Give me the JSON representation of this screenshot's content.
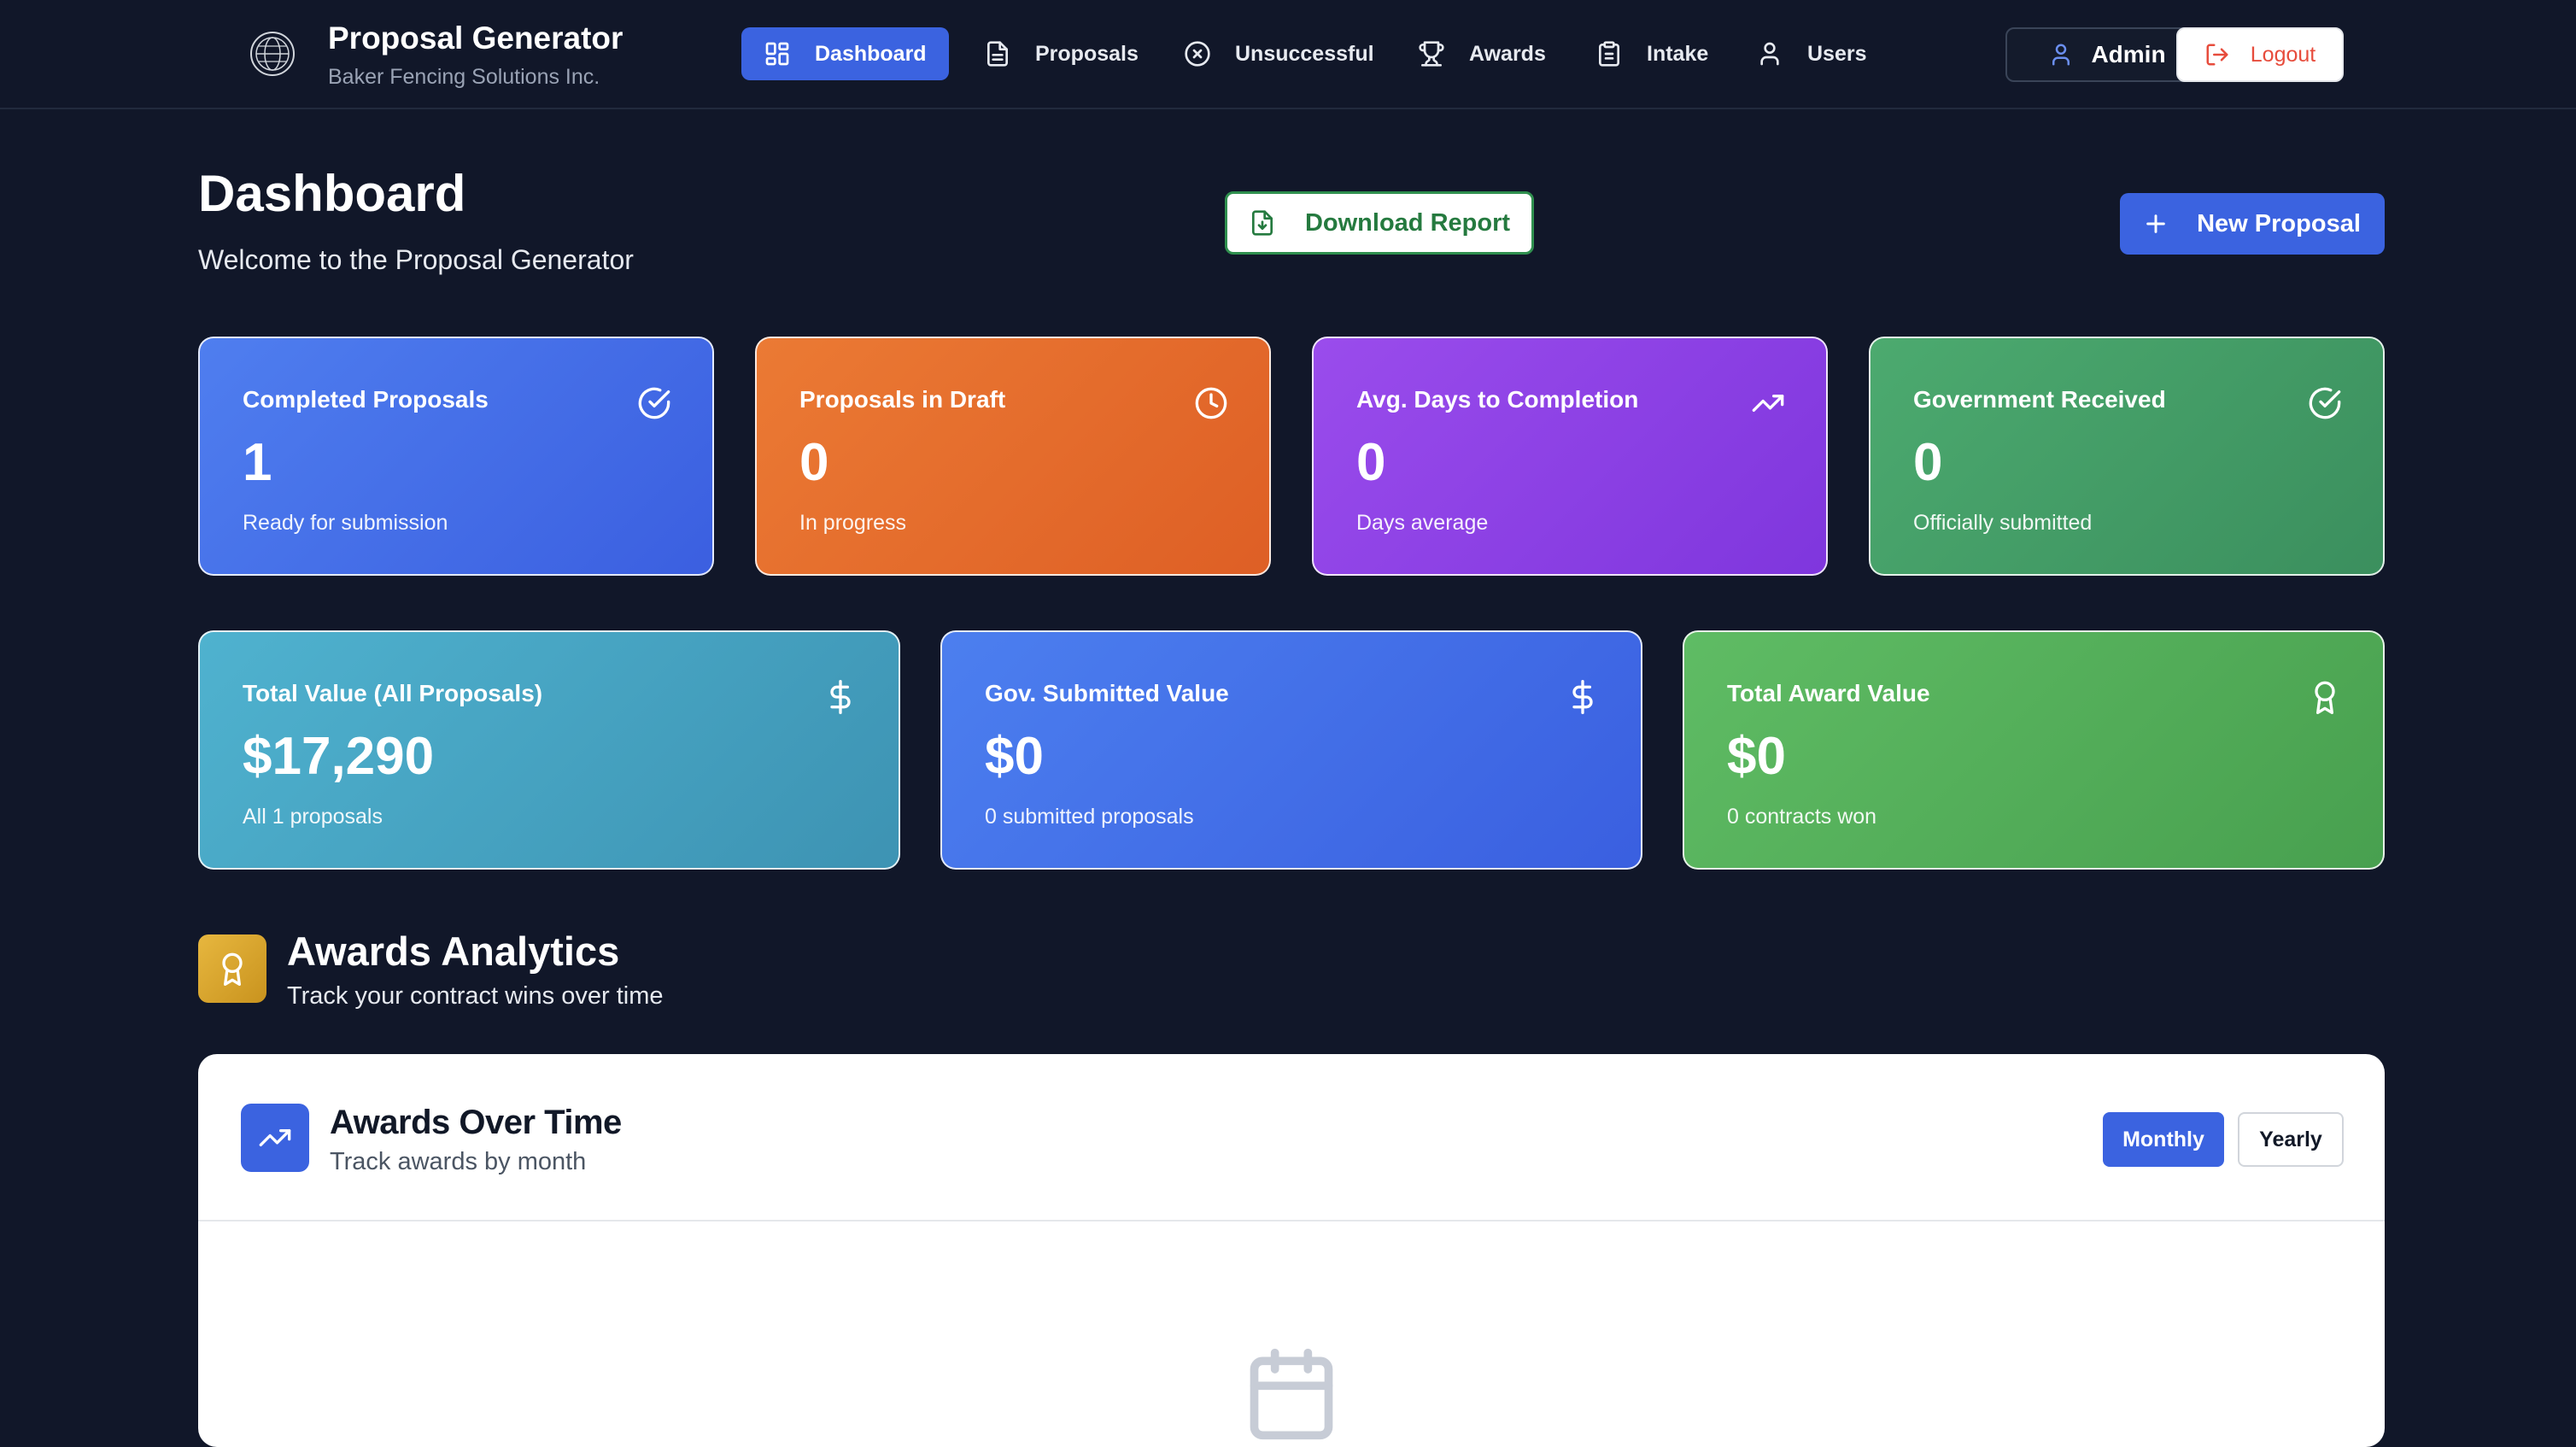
{
  "brand": {
    "title": "Proposal Generator",
    "subtitle": "Baker Fencing Solutions Inc.",
    "logo_icon": "globe-seal-icon"
  },
  "nav": {
    "items": [
      {
        "label": "Dashboard",
        "icon": "grid-icon",
        "active": true
      },
      {
        "label": "Proposals",
        "icon": "document-icon",
        "active": false
      },
      {
        "label": "Unsuccessful",
        "icon": "x-circle-icon",
        "active": false
      },
      {
        "label": "Awards",
        "icon": "trophy-icon",
        "active": false
      },
      {
        "label": "Intake",
        "icon": "clipboard-icon",
        "active": false
      },
      {
        "label": "Users",
        "icon": "user-icon",
        "active": false
      }
    ],
    "admin_label": "Admin",
    "logout_label": "Logout"
  },
  "header": {
    "title": "Dashboard",
    "subtitle": "Welcome to the Proposal Generator",
    "download_label": "Download Report",
    "new_label": "New Proposal"
  },
  "stats_row1": [
    {
      "title": "Completed Proposals",
      "value": "1",
      "desc": "Ready for submission",
      "icon": "check-circle-icon",
      "color": "#4a74ea"
    },
    {
      "title": "Proposals in Draft",
      "value": "0",
      "desc": "In progress",
      "icon": "clock-icon",
      "color": "#e56e2e"
    },
    {
      "title": "Avg. Days to Completion",
      "value": "0",
      "desc": "Days average",
      "icon": "trending-up-icon",
      "color": "#8c42e5"
    },
    {
      "title": "Government Received",
      "value": "0",
      "desc": "Officially submitted",
      "icon": "check-circle-icon",
      "color": "#449e67"
    }
  ],
  "stats_row2": [
    {
      "title": "Total Value (All Proposals)",
      "value": "$17,290",
      "desc": "All 1 proposals",
      "icon": "dollar-icon",
      "color": "#47a3c2"
    },
    {
      "title": "Gov. Submitted Value",
      "value": "$0",
      "desc": "0 submitted proposals",
      "icon": "dollar-icon",
      "color": "#4470e8"
    },
    {
      "title": "Total Award Value",
      "value": "$0",
      "desc": "0 contracts won",
      "icon": "award-icon",
      "color": "#53ad59"
    }
  ],
  "analytics": {
    "title": "Awards Analytics",
    "subtitle": "Track your contract wins over time",
    "panel_title": "Awards Over Time",
    "panel_subtitle": "Track awards by month",
    "toggle_monthly": "Monthly",
    "toggle_yearly": "Yearly",
    "empty_icon": "calendar-icon"
  }
}
